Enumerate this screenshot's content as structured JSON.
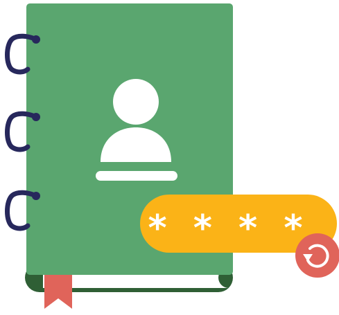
{
  "illustration": {
    "password_mask": "* * * *",
    "icons": {
      "book": "address-book-icon",
      "user": "user-icon",
      "reset": "reset-password-icon"
    },
    "colors": {
      "cover": "#5aa66f",
      "spine": "#2f5f35",
      "pages": "#ffffff",
      "rings": "#27285c",
      "bookmark": "#e0645a",
      "pill": "#fbb317",
      "reset_button": "#e0645a",
      "user": "#ffffff"
    }
  }
}
